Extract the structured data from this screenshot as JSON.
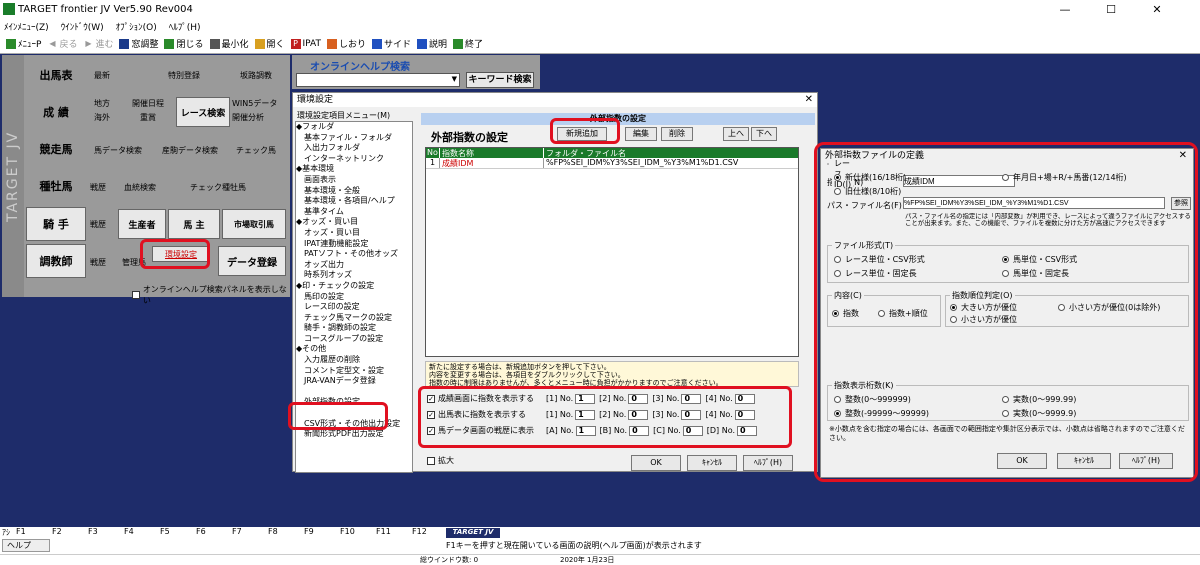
{
  "app": {
    "title": "TARGET frontier JV  Ver5.90  Rev004",
    "min": "—",
    "max": "☐",
    "close": "✕"
  },
  "menu": [
    "ﾒｲﾝﾒﾆｭｰ(Z)",
    "ｳｲﾝﾄﾞｳ(W)",
    "ｵﾌﾟｼｮﾝ(O)",
    "ﾍﾙﾌﾟ(H)"
  ],
  "toolbar": [
    "ﾒﾆｭｰP",
    "戻る",
    "進む",
    "窓調整",
    "閉じる",
    "最小化",
    "開く",
    "IPAT",
    "しおり",
    "サイド",
    "説明",
    "終了"
  ],
  "left": {
    "logo": "TARGET JV",
    "r1": {
      "main": "出馬表",
      "a": "最新",
      "b": "特別登録",
      "c": "坂路調教"
    },
    "r2": {
      "main": "成 績",
      "a": "地方",
      "a2": "海外",
      "b": "開催日程",
      "b2": "重賞",
      "c": "レース検索",
      "d": "WIN5データ",
      "d2": "開催分析"
    },
    "r3": {
      "main": "競走馬",
      "a": "馬データ検索",
      "b": "産駒データ検索",
      "c": "チェック馬"
    },
    "r4": {
      "main": "種牡馬",
      "a": "戦歴",
      "b": "血統検索",
      "c": "チェック種牡馬"
    },
    "r5": {
      "main": "騎 手",
      "a": "戦歴",
      "b": "生産者",
      "c": "馬 主",
      "d": "市場取引馬"
    },
    "r6": {
      "main": "調教師",
      "a": "戦歴",
      "b": "管理馬",
      "c": "環境設定",
      "d": "データ登録"
    },
    "chk": "オンラインヘルプ検索パネルを表示しない"
  },
  "help": {
    "title": "オンラインヘルプ検索",
    "button": "キーワード検索"
  },
  "dlg1": {
    "title": "環境設定",
    "tree_header": "環境設定項目メニュー(M)",
    "panel_title": "外部指数の設定",
    "heading": "外部指数の設定",
    "btn_new": "新規追加",
    "btn_edit": "編集",
    "btn_del": "削除",
    "btn_up": "上へ",
    "btn_down": "下へ",
    "cols": [
      "No",
      "指数名称",
      "フォルダ・ファイル名"
    ],
    "row": [
      "1",
      "成績IDM",
      "%FP%SEI_IDM%Y3%SEI_IDM_%Y3%M1%D1.CSV"
    ],
    "tree": [
      "◆フォルダ",
      "　基本ファイル・フォルダ",
      "　入出力フォルダ",
      "　インターネットリンク",
      "◆基本環境",
      "　画面表示",
      "　基本環境・全般",
      "　基本環境・各項目/ヘルプ",
      "　基準タイム",
      "◆オッズ・買い目",
      "　オッズ・買い目",
      "　IPAT連動機能設定",
      "　PATソフト・その他オッズ",
      "　オッズ出力",
      "　時系列オッズ",
      "◆印・チェックの設定",
      "　馬印の設定",
      "　レース印の設定",
      "　チェック馬マークの設定",
      "　騎手・調教師の設定",
      "　コースグループの設定",
      "◆その他",
      "　入力履歴の削除",
      "　コメント定型文・設定",
      "　JRA-VANデータ登録",
      "　",
      "　外部指数の設定",
      "　",
      "　CSV形式・その他出力設定",
      "　新聞形式PDF出力設定"
    ],
    "info": "新たに設定する場合は、新規追加ボタンを押して下さい。\n内容を変更する場合は、各項目をダブルクリックして下さい。\n指数の時に制限はありませんが、多くとメニュー時に負担がかかりますのでご注意ください。",
    "checks": [
      {
        "label": "成績画面に指数を表示する",
        "p": "[1] No.",
        "v": "1",
        "p2": "[2] No.",
        "v2": "0",
        "p3": "[3] No.",
        "v3": "0",
        "p4": "[4] No.",
        "v4": "0"
      },
      {
        "label": "出馬表に指数を表示する",
        "p": "[1] No.",
        "v": "1",
        "p2": "[2] No.",
        "v2": "0",
        "p3": "[3] No.",
        "v3": "0",
        "p4": "[4] No.",
        "v4": "0"
      },
      {
        "label": "馬データ画面の戦歴に表示",
        "p": "[A] No.",
        "v": "1",
        "p2": "[B] No.",
        "v2": "0",
        "p3": "[C] No.",
        "v3": "0",
        "p4": "[D] No.",
        "v4": "0"
      }
    ],
    "expand": "拡大",
    "ok": "OK",
    "cancel": "ｷｬﾝｾﾙ",
    "help": "ﾍﾙﾌﾟ(H)"
  },
  "dlg2": {
    "title": "外部指数ファイルの定義",
    "name_label": "指数名(N)",
    "name_value": "成績IDM",
    "path_label": "パス・ファイル名(F)",
    "path_value": "%FP%SEI_IDM%Y3%SEI_IDM_%Y3%M1%D1.CSV",
    "ref": "参照",
    "note": "パス・ファイル名の指定には「内部変数」が利用でき、レースによって違うファイルにアクセスすることが出来ます。また、この機能で、ファイルを複数に分けた方が高速にアクセスできます",
    "fmt": {
      "label": "ファイル形式(T)",
      "o1": "レース単位・CSV形式",
      "o2": "馬単位・CSV形式",
      "o3": "レース単位・固定長",
      "o4": "馬単位・固定長"
    },
    "content": {
      "label": "内容(C)",
      "o1": "指数",
      "o2": "指数+順位"
    },
    "rank": {
      "label": "指数順位判定(O)",
      "o1": "大きい方が優位",
      "o2": "小さい方が優位(0は除外)",
      "o3": "小さい方が優位"
    },
    "raceid": {
      "label": "レースID(I)",
      "o1": "新仕様(16/18桁)",
      "o2": "年月日+場+R/+馬番(12/14桁)",
      "o3": "旧仕様(8/10桁)"
    },
    "digits": {
      "label": "指数表示桁数(K)",
      "o1": "整数(0～999999)",
      "o2": "実数(0～999.99)",
      "o3": "整数(-99999～99999)",
      "o4": "実数(0～9999.9)"
    },
    "note2": "※小数点を含む指定の場合には、各画面での範囲指定や集計区分表示では、小数点は省略されますのでご注意ください。",
    "ok": "OK",
    "cancel": "ｷｬﾝｾﾙ",
    "help": "ﾍﾙﾌﾟ(H)"
  },
  "fkeys": {
    "keys": [
      "F1",
      "F2",
      "F3",
      "F4",
      "F5",
      "F6",
      "F7",
      "F8",
      "F9",
      "F10",
      "F11",
      "F12"
    ],
    "help": "ヘルプ",
    "logo": "TARGET JV",
    "hint": "F1キーを押すと現在開いている画面の説明(ヘルプ画面)が表示されます",
    "wincount": "総ウインドウ数: 0",
    "date": "2020年 1月23日",
    "prefix": "ｱｼ"
  }
}
